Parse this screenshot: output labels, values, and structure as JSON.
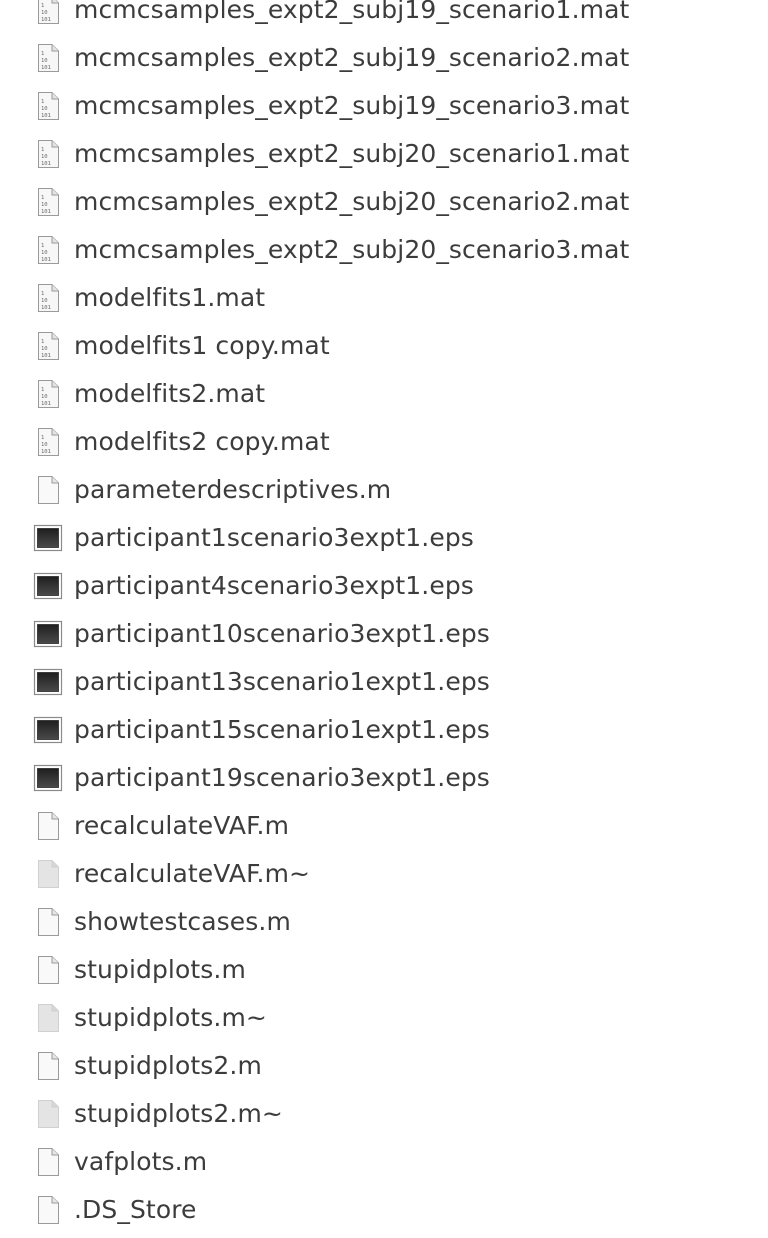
{
  "file_list": {
    "items": [
      {
        "name": "mcmcsamples_expt2_subj19_scenario1.mat",
        "icon": "binary-file-icon"
      },
      {
        "name": "mcmcsamples_expt2_subj19_scenario2.mat",
        "icon": "binary-file-icon"
      },
      {
        "name": "mcmcsamples_expt2_subj19_scenario3.mat",
        "icon": "binary-file-icon"
      },
      {
        "name": "mcmcsamples_expt2_subj20_scenario1.mat",
        "icon": "binary-file-icon"
      },
      {
        "name": "mcmcsamples_expt2_subj20_scenario2.mat",
        "icon": "binary-file-icon"
      },
      {
        "name": "mcmcsamples_expt2_subj20_scenario3.mat",
        "icon": "binary-file-icon"
      },
      {
        "name": "modelfits1.mat",
        "icon": "binary-file-icon"
      },
      {
        "name": "modelfits1 copy.mat",
        "icon": "binary-file-icon"
      },
      {
        "name": "modelfits2.mat",
        "icon": "binary-file-icon"
      },
      {
        "name": "modelfits2 copy.mat",
        "icon": "binary-file-icon"
      },
      {
        "name": "parameterdescriptives.m",
        "icon": "text-file-icon"
      },
      {
        "name": "participant1scenario3expt1.eps",
        "icon": "image-file-icon"
      },
      {
        "name": "participant4scenario3expt1.eps",
        "icon": "image-file-icon"
      },
      {
        "name": "participant10scenario3expt1.eps",
        "icon": "image-file-icon"
      },
      {
        "name": "participant13scenario1expt1.eps",
        "icon": "image-file-icon"
      },
      {
        "name": "participant15scenario1expt1.eps",
        "icon": "image-file-icon"
      },
      {
        "name": "participant19scenario3expt1.eps",
        "icon": "image-file-icon"
      },
      {
        "name": "recalculateVAF.m",
        "icon": "text-file-icon"
      },
      {
        "name": "recalculateVAF.m~",
        "icon": "backup-file-icon"
      },
      {
        "name": "showtestcases.m",
        "icon": "text-file-icon"
      },
      {
        "name": "stupidplots.m",
        "icon": "text-file-icon"
      },
      {
        "name": "stupidplots.m~",
        "icon": "backup-file-icon"
      },
      {
        "name": "stupidplots2.m",
        "icon": "text-file-icon"
      },
      {
        "name": "stupidplots2.m~",
        "icon": "backup-file-icon"
      },
      {
        "name": "vafplots.m",
        "icon": "text-file-icon"
      },
      {
        "name": ".DS_Store",
        "icon": "text-file-icon"
      }
    ]
  }
}
